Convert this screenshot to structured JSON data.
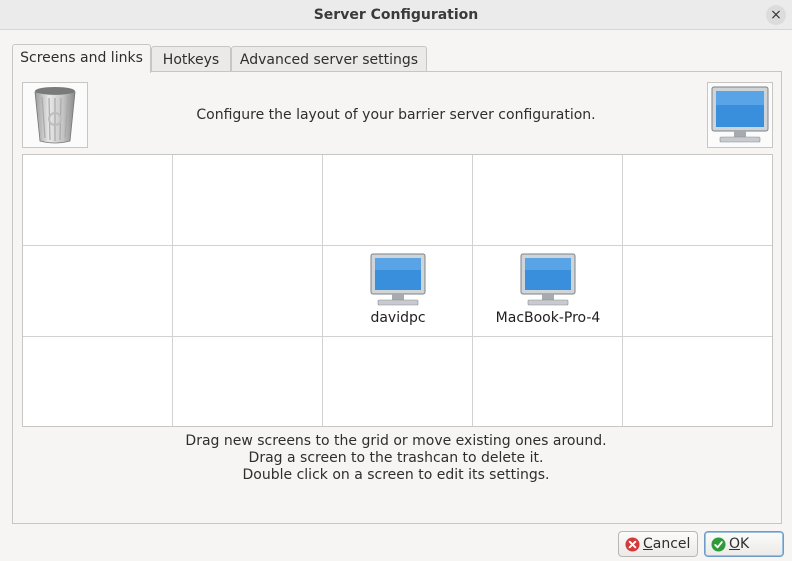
{
  "window": {
    "title": "Server Configuration",
    "close_glyph": "×"
  },
  "tabs": [
    {
      "label": "Screens and links",
      "active": true
    },
    {
      "label": "Hotkeys",
      "active": false
    },
    {
      "label": "Advanced server settings",
      "active": false
    }
  ],
  "intro_text": "Configure the layout of your barrier server configuration.",
  "icons": {
    "trash": "trashcan-icon",
    "new_screen": "monitor-icon"
  },
  "grid": {
    "columns": 5,
    "rows": 3,
    "screens": [
      {
        "name": "davidpc",
        "row": 2,
        "col": 3
      },
      {
        "name": "MacBook-Pro-4",
        "row": 2,
        "col": 4
      }
    ]
  },
  "help": {
    "line1": "Drag new screens to the grid or move existing ones around.",
    "line2": "Drag a screen to the trashcan to delete it.",
    "line3": "Double click on a screen to edit its settings."
  },
  "buttons": {
    "cancel": {
      "label": "Cancel",
      "mnemonic": "C"
    },
    "ok": {
      "label": "OK",
      "mnemonic": "O"
    }
  },
  "colors": {
    "cancel_icon": "#d23b3b",
    "ok_icon": "#2f9a3a",
    "screen_blue": "#3a8fdd"
  }
}
